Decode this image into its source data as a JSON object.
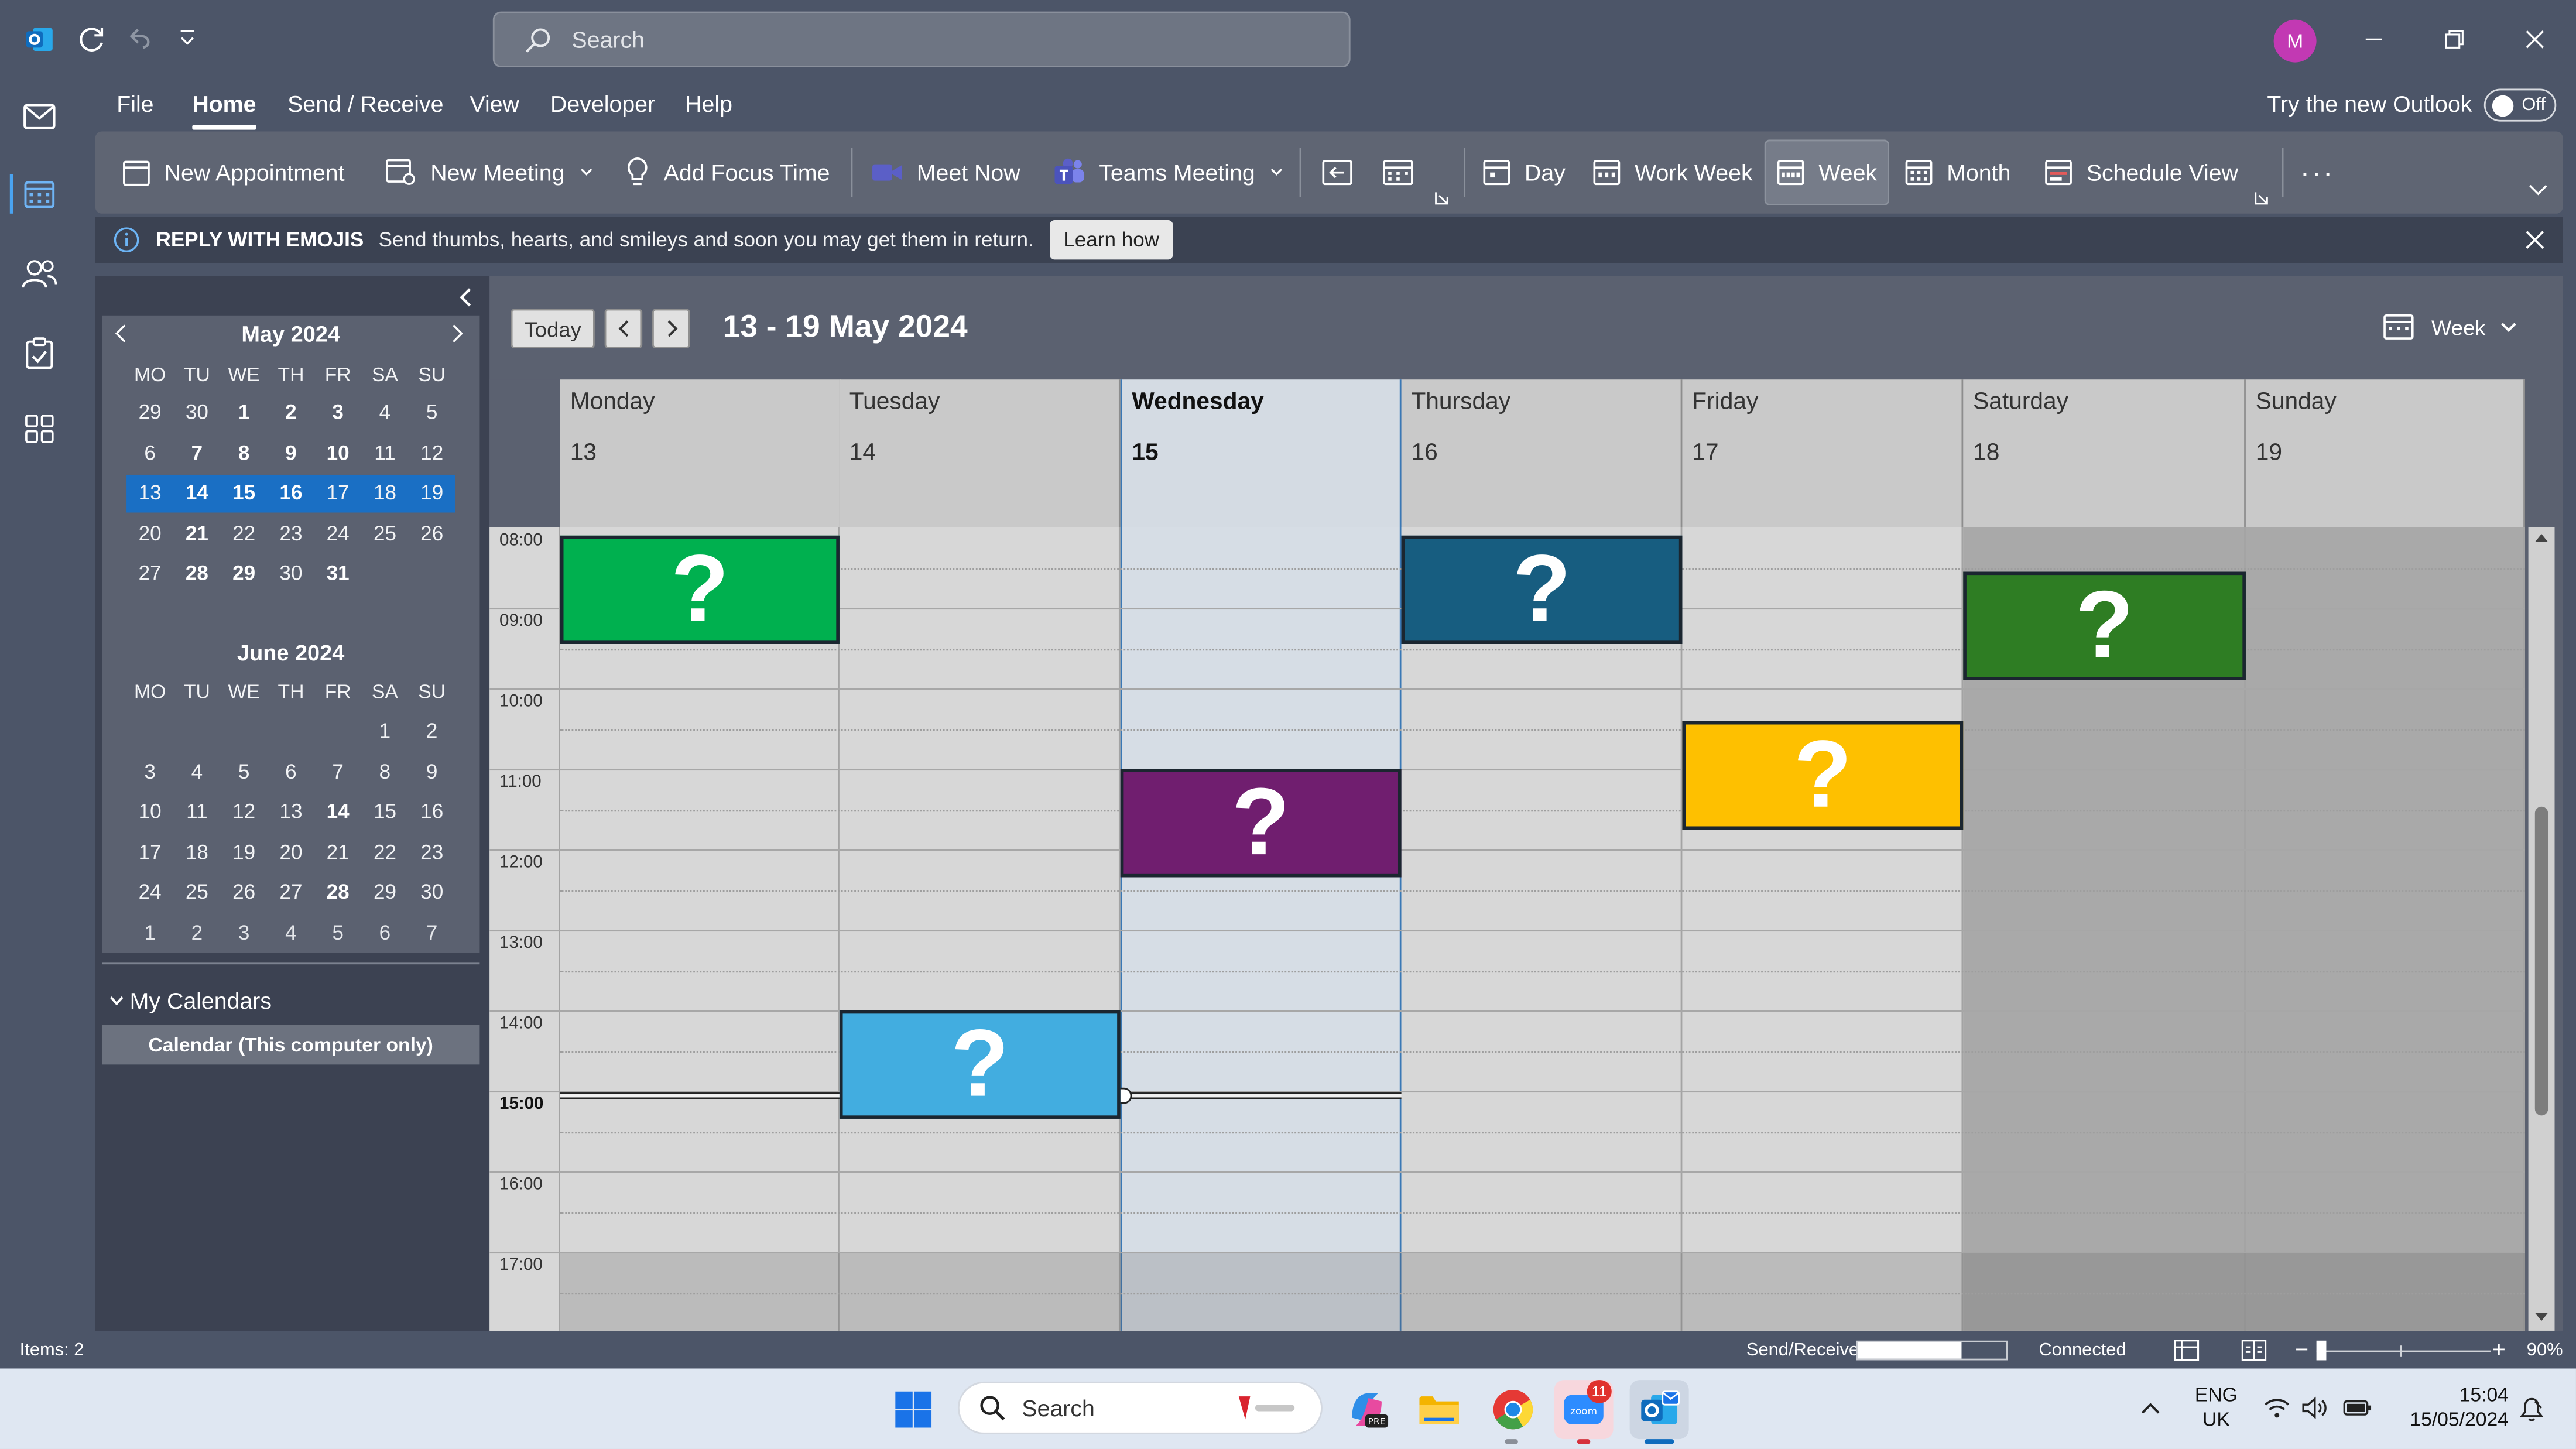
{
  "titlebar": {
    "search_placeholder": "Search",
    "avatar_initial": "M"
  },
  "menu": {
    "items": [
      "File",
      "Home",
      "Send / Receive",
      "View",
      "Developer",
      "Help"
    ],
    "active": "Home",
    "new_outlook_label": "Try the new Outlook",
    "toggle_state": "Off"
  },
  "ribbon": {
    "new_appointment": "New Appointment",
    "new_meeting": "New Meeting",
    "add_focus_time": "Add Focus Time",
    "meet_now": "Meet Now",
    "teams_meeting": "Teams Meeting",
    "day": "Day",
    "work_week": "Work Week",
    "week": "Week",
    "month": "Month",
    "schedule_view": "Schedule View",
    "more": "···"
  },
  "infobar": {
    "heading": "REPLY WITH EMOJIS",
    "message": "Send thumbs, hearts, and smileys and soon you may get them in return.",
    "learn_more": "Learn how"
  },
  "minical": {
    "weekday_headers": [
      "MO",
      "TU",
      "WE",
      "TH",
      "FR",
      "SA",
      "SU"
    ],
    "may": {
      "title": "May 2024",
      "rows": [
        [
          "29",
          "30",
          "1",
          "2",
          "3",
          "4",
          "5"
        ],
        [
          "6",
          "7",
          "8",
          "9",
          "10",
          "11",
          "12"
        ],
        [
          "13",
          "14",
          "15",
          "16",
          "17",
          "18",
          "19"
        ],
        [
          "20",
          "21",
          "22",
          "23",
          "24",
          "25",
          "26"
        ],
        [
          "27",
          "28",
          "29",
          "30",
          "31",
          "",
          ""
        ]
      ]
    },
    "june": {
      "title": "June 2024",
      "rows": [
        [
          "",
          "",
          "",
          "",
          "",
          "1",
          "2"
        ],
        [
          "3",
          "4",
          "5",
          "6",
          "7",
          "8",
          "9"
        ],
        [
          "10",
          "11",
          "12",
          "13",
          "14",
          "15",
          "16"
        ],
        [
          "17",
          "18",
          "19",
          "20",
          "21",
          "22",
          "23"
        ],
        [
          "24",
          "25",
          "26",
          "27",
          "28",
          "29",
          "30"
        ],
        [
          "1",
          "2",
          "3",
          "4",
          "5",
          "6",
          "7"
        ]
      ]
    }
  },
  "calendars": {
    "group": "My Calendars",
    "item": "Calendar (This computer only)"
  },
  "calendar_view": {
    "today_button": "Today",
    "range_title": "13 - 19 May 2024",
    "view_selector": "Week",
    "days": [
      {
        "name": "Monday",
        "date": "13"
      },
      {
        "name": "Tuesday",
        "date": "14"
      },
      {
        "name": "Wednesday",
        "date": "15"
      },
      {
        "name": "Thursday",
        "date": "16"
      },
      {
        "name": "Friday",
        "date": "17"
      },
      {
        "name": "Saturday",
        "date": "18"
      },
      {
        "name": "Sunday",
        "date": "19"
      }
    ],
    "time_labels": [
      "08:00",
      "09:00",
      "10:00",
      "11:00",
      "12:00",
      "13:00",
      "14:00",
      "15:00",
      "16:00",
      "17:00"
    ],
    "current_time_label": "15:00",
    "events": [
      {
        "label": "?",
        "color": "#00b04f"
      },
      {
        "label": "?",
        "color": "#175d80"
      },
      {
        "label": "?",
        "color": "#2e7d23"
      },
      {
        "label": "?",
        "color": "#fec000"
      },
      {
        "label": "?",
        "color": "#701e6f"
      },
      {
        "label": "?",
        "color": "#42ade0"
      }
    ]
  },
  "statusbar": {
    "items": "Items: 2",
    "send_receive": "Send/Receive",
    "connected": "Connected",
    "zoom": "90%"
  },
  "taskbar": {
    "search_placeholder": "Search",
    "lang_top": "ENG",
    "lang_bottom": "UK",
    "time": "15:04",
    "date": "15/05/2024",
    "zoom_badge": "11"
  }
}
